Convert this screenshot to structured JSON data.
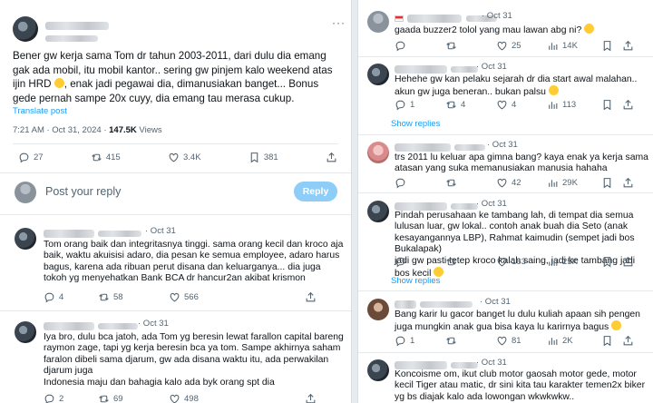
{
  "main_post": {
    "text": "Bener gw kerja sama Tom dr tahun 2003-2011, dari dulu dia emang gak ada mobil, itu mobil kantor.. sering gw pinjem kalo weekend atas ijin HRD",
    "text2": ", enak jadi pegawai dia, dimanusiakan banget... Bonus gede pernah sampe 20x cuyy, dia emang tau merasa cukup.",
    "translate": "Translate post",
    "time": "7:21 AM · Oct 31, 2024 · ",
    "views": "147.5K",
    "views_label": " Views",
    "stats": {
      "replies": "27",
      "reposts": "415",
      "likes": "3.4K",
      "bookmarks": "381"
    }
  },
  "compose": {
    "placeholder": "Post your reply",
    "button": "Reply"
  },
  "left_replies": [
    {
      "date": "· Oct 31",
      "text": "Tom orang baik dan integritasnya tinggi. sama orang kecil dan kroco aja baik, waktu akuisisi adaro, dia pesan ke semua employee, adaro harus bagus, karena ada ribuan perut disana dan keluarganya... dia juga tokoh yg menyehatkan Bank BCA dr hancur2an akibat krismon",
      "stats": {
        "replies": "4",
        "reposts": "58",
        "likes": "566",
        "views": ""
      }
    },
    {
      "date": "· Oct 31",
      "text": "Iya bro, dulu bca jatoh, ada Tom yg beresin lewat farallon capital bareng raymon zage, tapi yg kerja beresin bca ya tom. Sampe akhirnya saham faralon dibeli sama djarum, gw ada disana waktu itu, ada perwakilan djarum juga\nIndonesia maju dan bahagia kalo ada byk orang spt dia",
      "stats": {
        "replies": "2",
        "reposts": "69",
        "likes": "498",
        "views": ""
      }
    }
  ],
  "right_replies": [
    {
      "date": "· Oct 31",
      "text": "gaada buzzer2 tolol yang mau lawan abg ni?",
      "stats": {
        "replies": "",
        "reposts": "",
        "likes": "25",
        "views": "14K"
      },
      "show_replies": ""
    },
    {
      "date": "· Oct 31",
      "text": "Hehehe gw kan pelaku sejarah dr dia start awal malahan.. akun gw juga beneran.. bukan palsu",
      "stats": {
        "replies": "1",
        "reposts": "4",
        "likes": "4",
        "views": "113"
      },
      "show_replies": "Show replies"
    },
    {
      "date": "· Oct 31",
      "text": "trs 2011 lu keluar apa gimna bang? kaya enak ya kerja sama atasan yang suka memanusiakan manusia hahaha",
      "stats": {
        "replies": "",
        "reposts": "",
        "likes": "42",
        "views": "29K"
      },
      "show_replies": ""
    },
    {
      "date": "· Oct 31",
      "text": "Pindah perusahaan ke tambang lah, di tempat dia semua lulusan luar, gw lokal.. contoh anak buah dia Seto (anak kesayangannya LBP), Rahmat kaimudin (sempet jadi bos Bukalapak)\njadi gw pasti tetep kroco kalah saing, jadi ke tambang jadi bos kecil",
      "stats": {
        "replies": "",
        "reposts": "",
        "likes": "163",
        "views": "25K"
      },
      "show_replies": "Show replies"
    },
    {
      "date": "· Oct 31",
      "text": "Bang karir lu gacor banget lu dulu kuliah apaan sih pengen juga mungkin anak gua bisa kaya lu karirnya bagus",
      "stats": {
        "replies": "1",
        "reposts": "",
        "likes": "81",
        "views": "2K"
      },
      "show_replies": ""
    },
    {
      "date": "· Oct 31",
      "text": "Koncoisme om, ikut club motor gaosah motor gede, motor kecil Tiger atau matic, dr sini kita tau karakter temen2x biker yg bs diajak kalo ada lowongan wkwkwkw..",
      "stats": {
        "replies": "",
        "reposts": "",
        "likes": "",
        "views": ""
      },
      "show_replies": ""
    }
  ],
  "icons": [
    "reply-icon",
    "repost-icon",
    "like-icon",
    "views-icon",
    "bookmark-icon",
    "share-icon",
    "more-icon",
    "emoji-icon",
    "flag-icon"
  ],
  "colors": {
    "link": "#1d9bf0",
    "muted": "#536471",
    "reply_button": "#8ecdf8"
  }
}
